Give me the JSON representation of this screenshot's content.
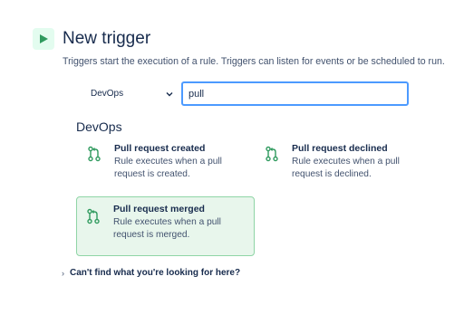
{
  "header": {
    "title": "New trigger",
    "description": "Triggers start the execution of a rule. Triggers can listen for events or be scheduled to run."
  },
  "filter": {
    "category_selected": "DevOps",
    "search_value": "pull"
  },
  "section": {
    "title": "DevOps"
  },
  "triggers": [
    {
      "title": "Pull request created",
      "description": "Rule executes when a pull request is created.",
      "icon": "pull-request-icon",
      "selected": false
    },
    {
      "title": "Pull request declined",
      "description": "Rule executes when a pull request is declined.",
      "icon": "pull-request-icon",
      "selected": false
    },
    {
      "title": "Pull request merged",
      "description": "Rule executes when a pull request is merged.",
      "icon": "pull-request-icon",
      "selected": true
    }
  ],
  "help": {
    "label": "Can't find what you're looking for here?"
  },
  "colors": {
    "accent": "#36b37e",
    "focus": "#4c9aff",
    "selected_bg": "#e8f6ec"
  }
}
